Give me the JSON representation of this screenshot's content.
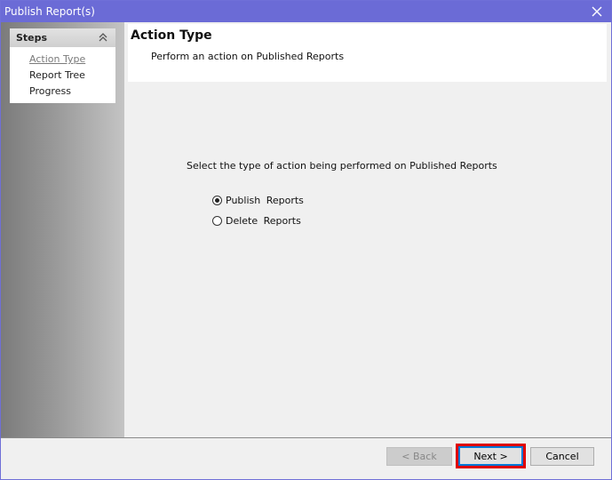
{
  "window": {
    "title": "Publish Report(s)"
  },
  "steps": {
    "header": "Steps",
    "items": [
      {
        "label": "Action Type",
        "active": true
      },
      {
        "label": "Report Tree",
        "active": false
      },
      {
        "label": "Progress",
        "active": false
      }
    ]
  },
  "page": {
    "title": "Action Type",
    "subtitle": "Perform an action on Published Reports",
    "prompt": "Select the type of action being performed on Published Reports"
  },
  "options": [
    {
      "label": "Publish  Reports",
      "checked": true
    },
    {
      "label": "Delete  Reports",
      "checked": false
    }
  ],
  "footer": {
    "back_label": "< Back",
    "next_label": "Next >",
    "cancel_label": "Cancel"
  },
  "colors": {
    "titlebar": "#6b6bd6",
    "highlight": "#e00000",
    "focus": "#0078d7"
  }
}
